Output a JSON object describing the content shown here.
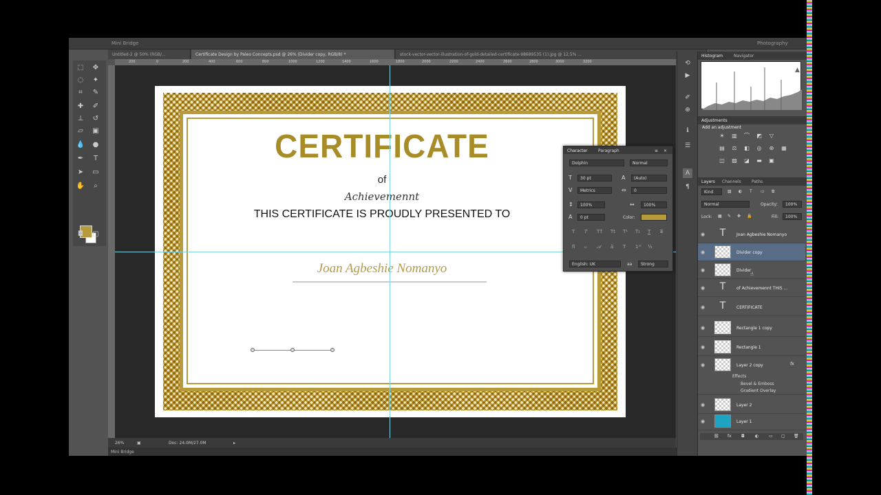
{
  "menubar": {
    "left_label": "Mini Bridge",
    "right_label": "Photography"
  },
  "tabs": [
    {
      "label": "Untitled-2 @ 50% (RGB/...",
      "active": false
    },
    {
      "label": "Certificate Design by Paleo Concepts.psd @ 26% (Divider copy, RGB/8) *",
      "active": true
    },
    {
      "label": "stock-vector-vector-illustration-of-gold-detailed-certificate-98689535 (1).jpg @ 12.5% ...",
      "active": false
    }
  ],
  "ruler": [
    "200",
    "0",
    "200",
    "400",
    "600",
    "800",
    "1000",
    "1200",
    "1400",
    "1600",
    "1800",
    "2000",
    "2200",
    "2400",
    "2600",
    "2800",
    "3000",
    "3200"
  ],
  "certificate": {
    "title": "CERTIFICATE",
    "of": "of",
    "script": "Achievemennt",
    "presented": "THIS CERTIFICATE IS PROUDLY PRESENTED TO",
    "name": "Joan Agbeshie Nomanyo"
  },
  "status": {
    "zoom": "26%",
    "doc": "Doc: 24.0M/27.0M"
  },
  "bottom_bar": {
    "label": "Mini Bridge"
  },
  "character_panel": {
    "tabs": [
      "Character",
      "Paragraph"
    ],
    "font_family": "Dolphin",
    "font_style": "Normal",
    "font_size": "30 pt",
    "leading": "(Auto)",
    "kerning": "Metrics",
    "tracking": "0",
    "vertical_scale": "100%",
    "horizontal_scale": "100%",
    "baseline": "0 pt",
    "color_label": "Color:",
    "color": "#b69b3c",
    "language": "English: UK",
    "antialias": "Strong",
    "aa_label": "aa"
  },
  "histogram_panel": {
    "tabs": [
      "Histogram",
      "Navigator"
    ]
  },
  "adjustments_panel": {
    "tab": "Adjustments",
    "title": "Add an adjustment"
  },
  "layers_panel": {
    "tabs": [
      "Layers",
      "Channels",
      "Paths"
    ],
    "kind": "Kind",
    "blend_mode": "Normal",
    "opacity_label": "Opacity:",
    "opacity": "100%",
    "lock_label": "Lock:",
    "fill_label": "Fill:",
    "fill": "100%",
    "layers": [
      {
        "name": "Joan Agbeshie Nomanyo",
        "type": "text",
        "selected": false
      },
      {
        "name": "Divider copy",
        "type": "raster",
        "selected": true
      },
      {
        "name": "Divider",
        "type": "raster",
        "selected": false
      },
      {
        "name": "of Achievemennt THIS ...",
        "type": "text",
        "selected": false
      },
      {
        "name": "CERTIFICATE",
        "type": "text",
        "selected": false
      },
      {
        "name": "Rectangle 1 copy",
        "type": "shape",
        "selected": false
      },
      {
        "name": "Rectangle 1",
        "type": "shape",
        "selected": false
      },
      {
        "name": "Layer 2 copy",
        "type": "raster",
        "selected": false
      },
      {
        "name": "Layer 2",
        "type": "raster",
        "selected": false
      },
      {
        "name": "Layer 1",
        "type": "fill",
        "selected": false
      }
    ],
    "effects_label": "Effects",
    "effects": [
      "Bevel & Emboss",
      "Gradient Overlay"
    ]
  }
}
